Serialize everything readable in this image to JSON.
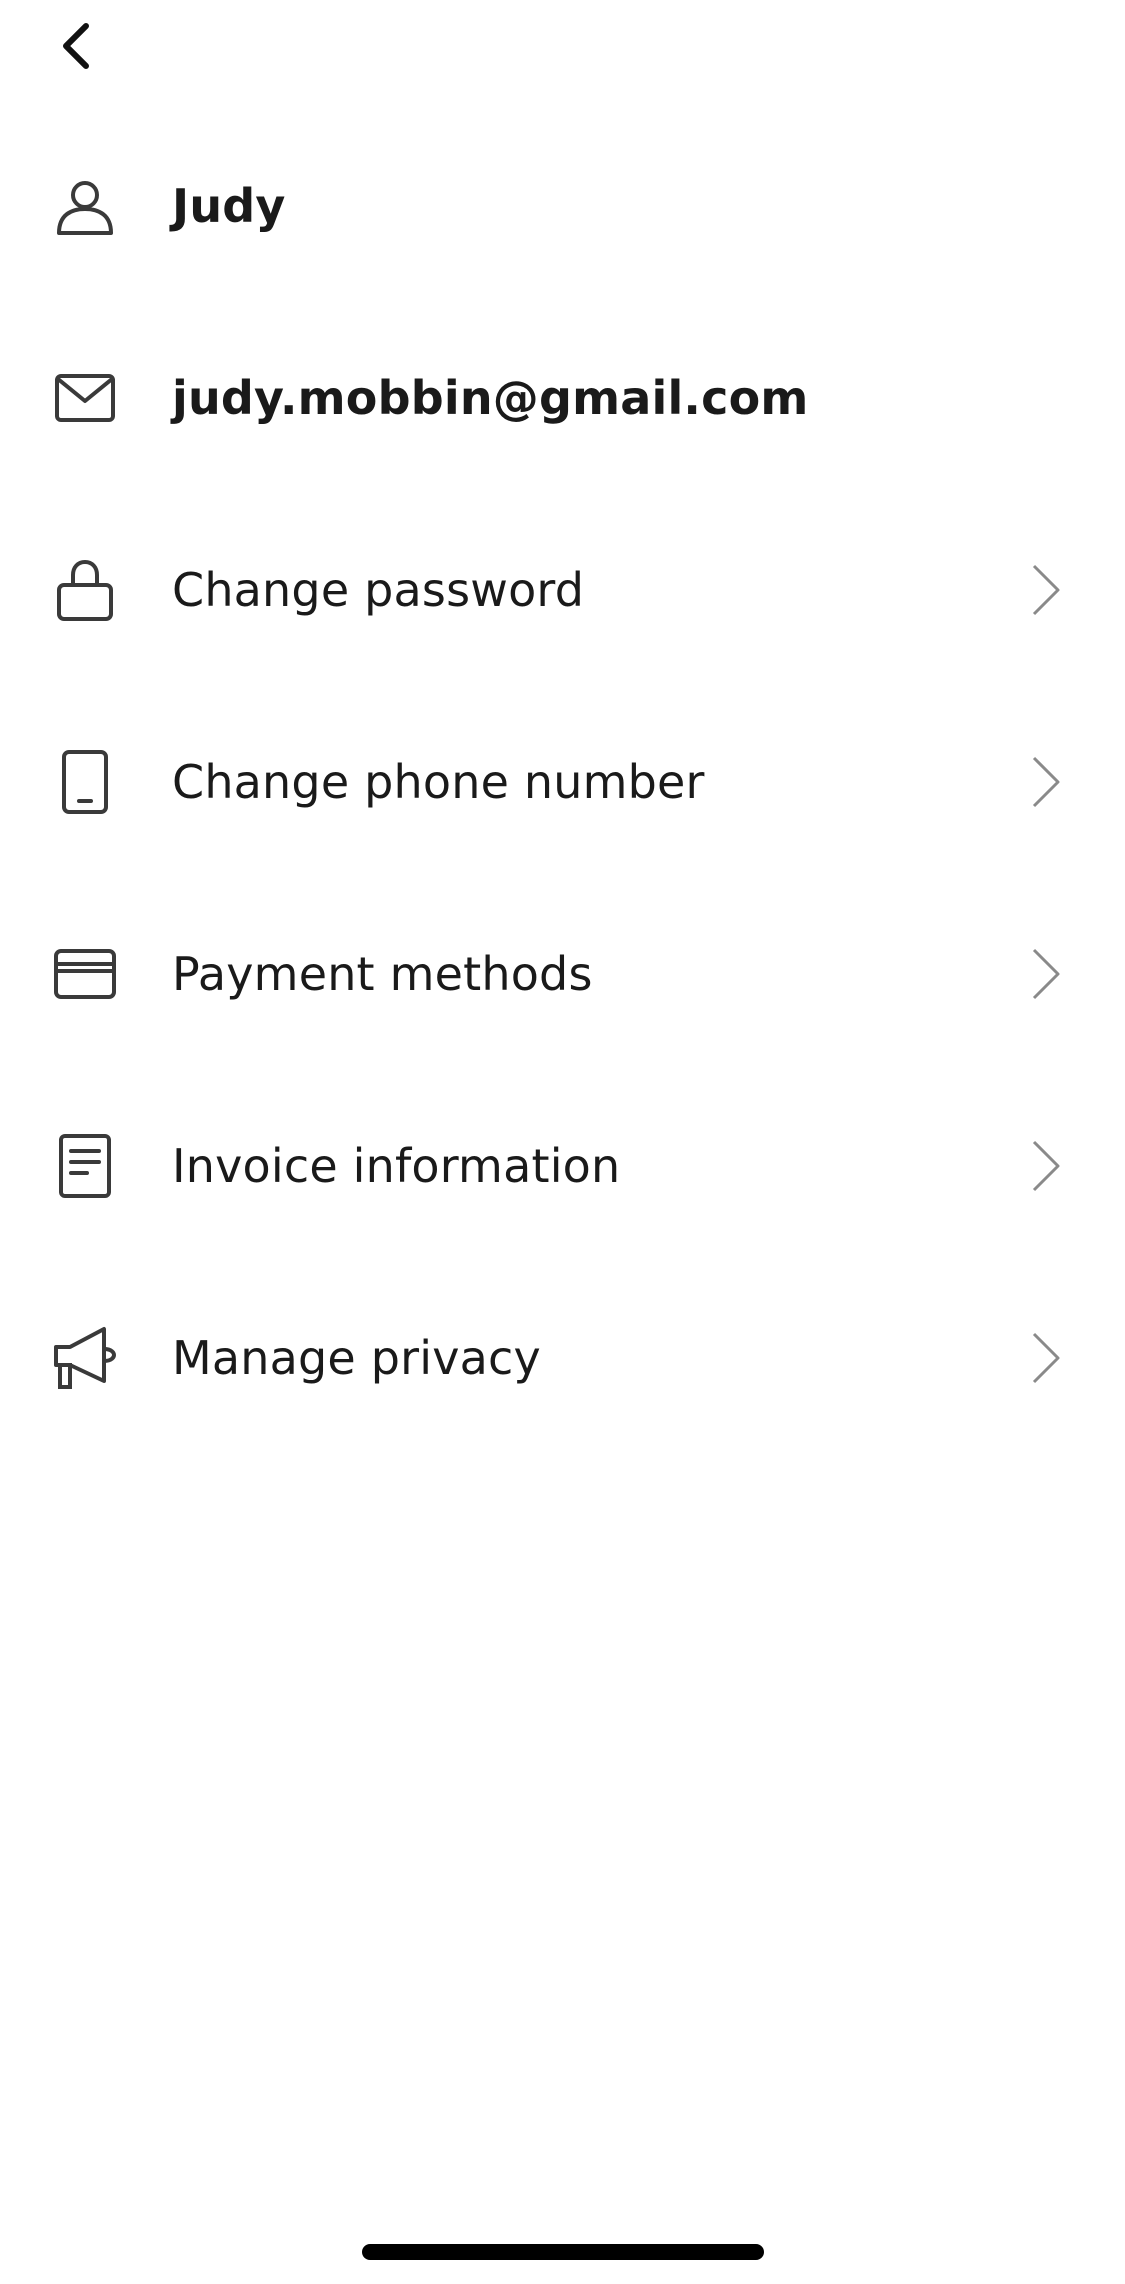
{
  "header": {
    "back_icon": "chevron-left-icon"
  },
  "account": {
    "name": "Judy",
    "email": "judy.mobbin@gmail.com"
  },
  "menu": {
    "items": [
      {
        "label": "Change password",
        "icon": "lock-icon"
      },
      {
        "label": "Change phone number",
        "icon": "phone-icon"
      },
      {
        "label": "Payment methods",
        "icon": "credit-card-icon"
      },
      {
        "label": "Invoice information",
        "icon": "document-icon"
      },
      {
        "label": "Manage privacy",
        "icon": "megaphone-icon"
      }
    ]
  },
  "colors": {
    "text": "#1a1a1a",
    "icon": "#3a3a3a",
    "chevron": "#8a8a8a",
    "background": "#ffffff"
  }
}
